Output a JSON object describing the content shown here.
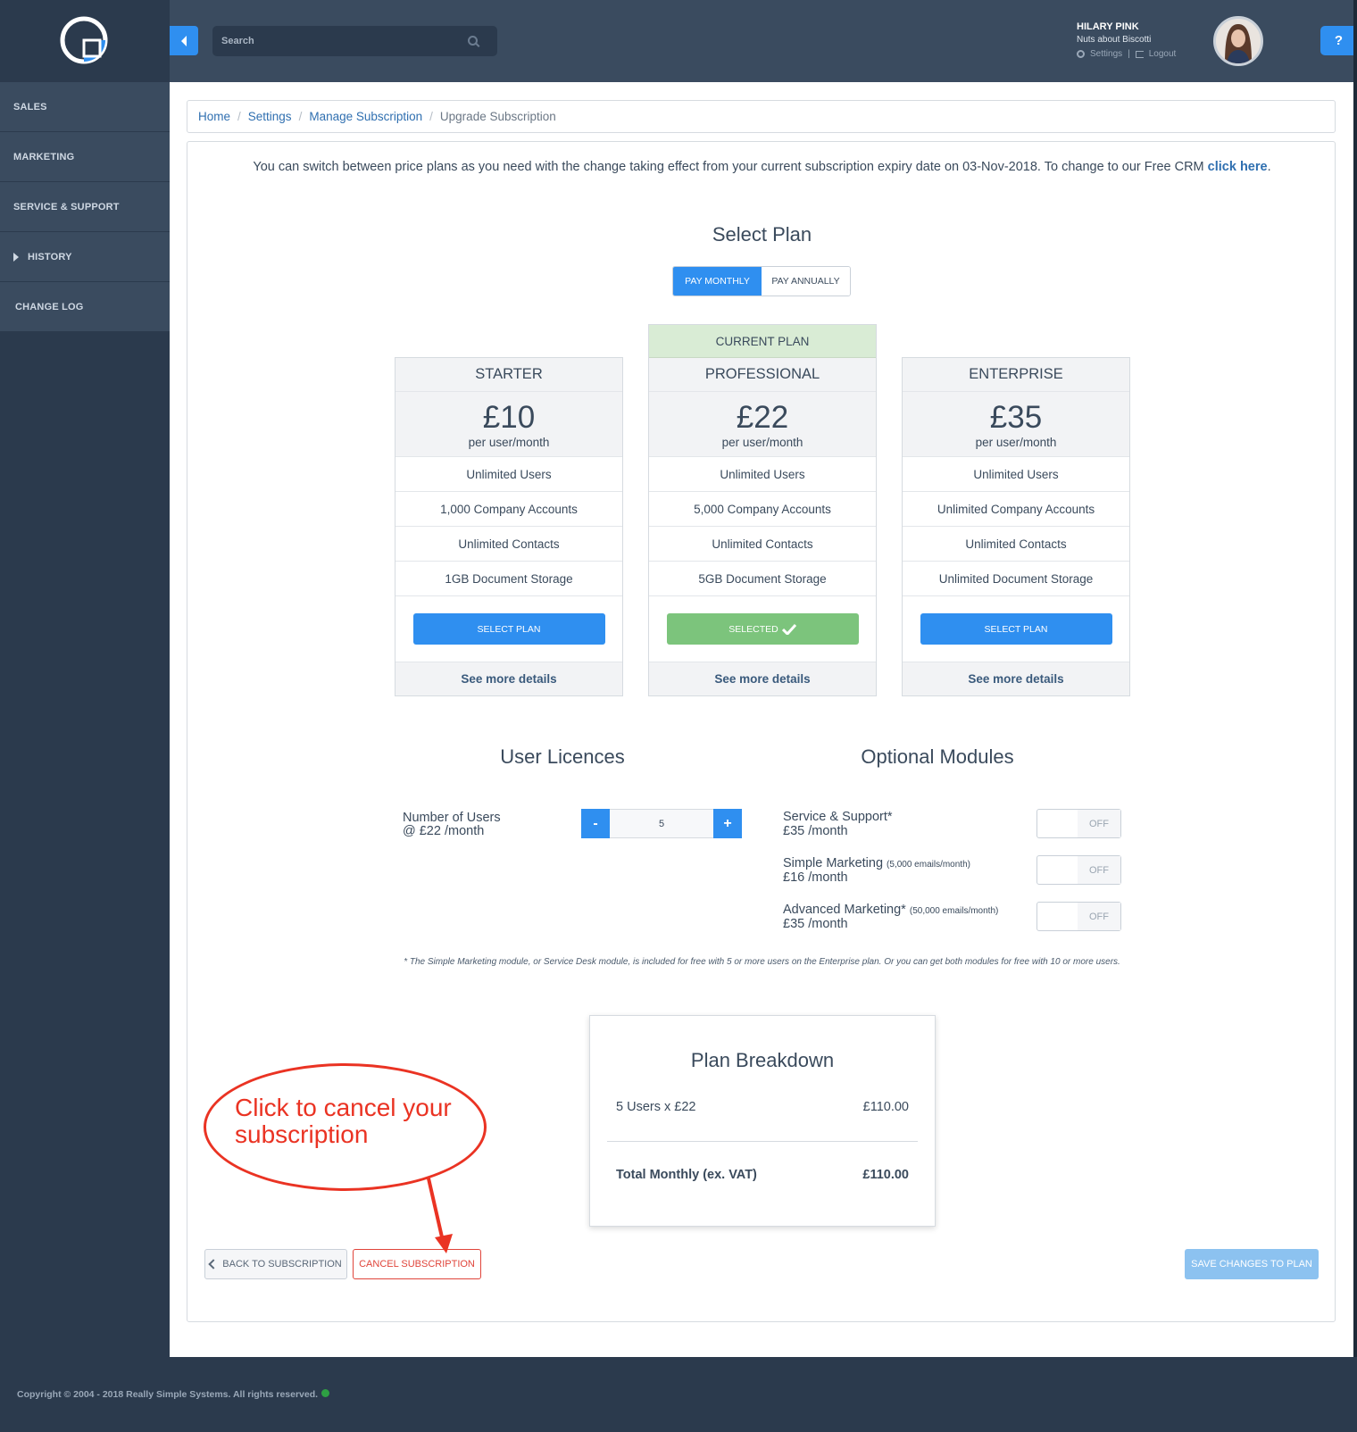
{
  "sidebar": {
    "items": [
      {
        "label": "SALES"
      },
      {
        "label": "MARKETING"
      },
      {
        "label": "SERVICE & SUPPORT"
      },
      {
        "label": "HISTORY"
      },
      {
        "label": "CHANGE LOG"
      }
    ]
  },
  "header": {
    "search_placeholder": "Search",
    "user_name": "HILARY PINK",
    "company": "Nuts about Biscotti",
    "settings_label": "Settings",
    "logout_label": "Logout",
    "help_label": "?"
  },
  "breadcrumb": {
    "items": [
      "Home",
      "Settings",
      "Manage Subscription"
    ],
    "current": "Upgrade Subscription"
  },
  "intro": {
    "text": "You can switch between price plans as you need with the change taking effect from your current subscription expiry date on 03-Nov-2018. To change to our Free CRM ",
    "link": "click here",
    "end": "."
  },
  "select_plan": {
    "title": "Select Plan",
    "toggle_monthly": "PAY MONTHLY",
    "toggle_annually": "PAY ANNUALLY",
    "active": "monthly"
  },
  "plans": [
    {
      "name": "STARTER",
      "price": "£10",
      "per": "per user/month",
      "features": [
        "Unlimited Users",
        "1,000 Company Accounts",
        "Unlimited Contacts",
        "1GB Document Storage"
      ],
      "button": "SELECT PLAN",
      "more": "See more details"
    },
    {
      "name": "PROFESSIONAL",
      "badge": "CURRENT PLAN",
      "price": "£22",
      "per": "per user/month",
      "features": [
        "Unlimited Users",
        "5,000 Company Accounts",
        "Unlimited Contacts",
        "5GB Document Storage"
      ],
      "button": "SELECTED",
      "more": "See more details"
    },
    {
      "name": "ENTERPRISE",
      "price": "£35",
      "per": "per user/month",
      "features": [
        "Unlimited Users",
        "Unlimited Company Accounts",
        "Unlimited Contacts",
        "Unlimited Document Storage"
      ],
      "button": "SELECT PLAN",
      "more": "See more details"
    }
  ],
  "licences": {
    "title": "User Licences",
    "label_line1": "Number of Users",
    "label_line2": "@ £22 /month",
    "value": "5",
    "minus": "-",
    "plus": "+"
  },
  "modules": {
    "title": "Optional Modules",
    "items": [
      {
        "name": "Service & Support*",
        "note": "",
        "price": "£35 /month",
        "state": "OFF"
      },
      {
        "name": "Simple Marketing",
        "note": "(5,000 emails/month)",
        "price": "£16 /month",
        "state": "OFF"
      },
      {
        "name": "Advanced Marketing*",
        "note": "(50,000 emails/month)",
        "price": "£35 /month",
        "state": "OFF"
      }
    ]
  },
  "footnote": "* The Simple Marketing module, or Service Desk module, is included for free with 5 or more users on the Enterprise plan. Or you can get both modules for free with 10 or more users.",
  "breakdown": {
    "title": "Plan Breakdown",
    "line_label": "5 Users x £22",
    "line_value": "£110.00",
    "total_label": "Total Monthly (ex. VAT)",
    "total_value": "£110.00"
  },
  "actions": {
    "back": "BACK TO SUBSCRIPTION",
    "cancel": "CANCEL SUBSCRIPTION",
    "save": "SAVE CHANGES TO PLAN"
  },
  "callout": {
    "line1": "Click to cancel your",
    "line2": "subscription"
  },
  "footer": {
    "copyright": "Copyright © 2004 - 2018 Really Simple Systems. All rights reserved."
  },
  "colors": {
    "accent": "#2f8ff0",
    "selected": "#7cc47c",
    "danger": "#e0443a",
    "annotation": "#ea3323",
    "sidebar": "#2b3a4d"
  }
}
